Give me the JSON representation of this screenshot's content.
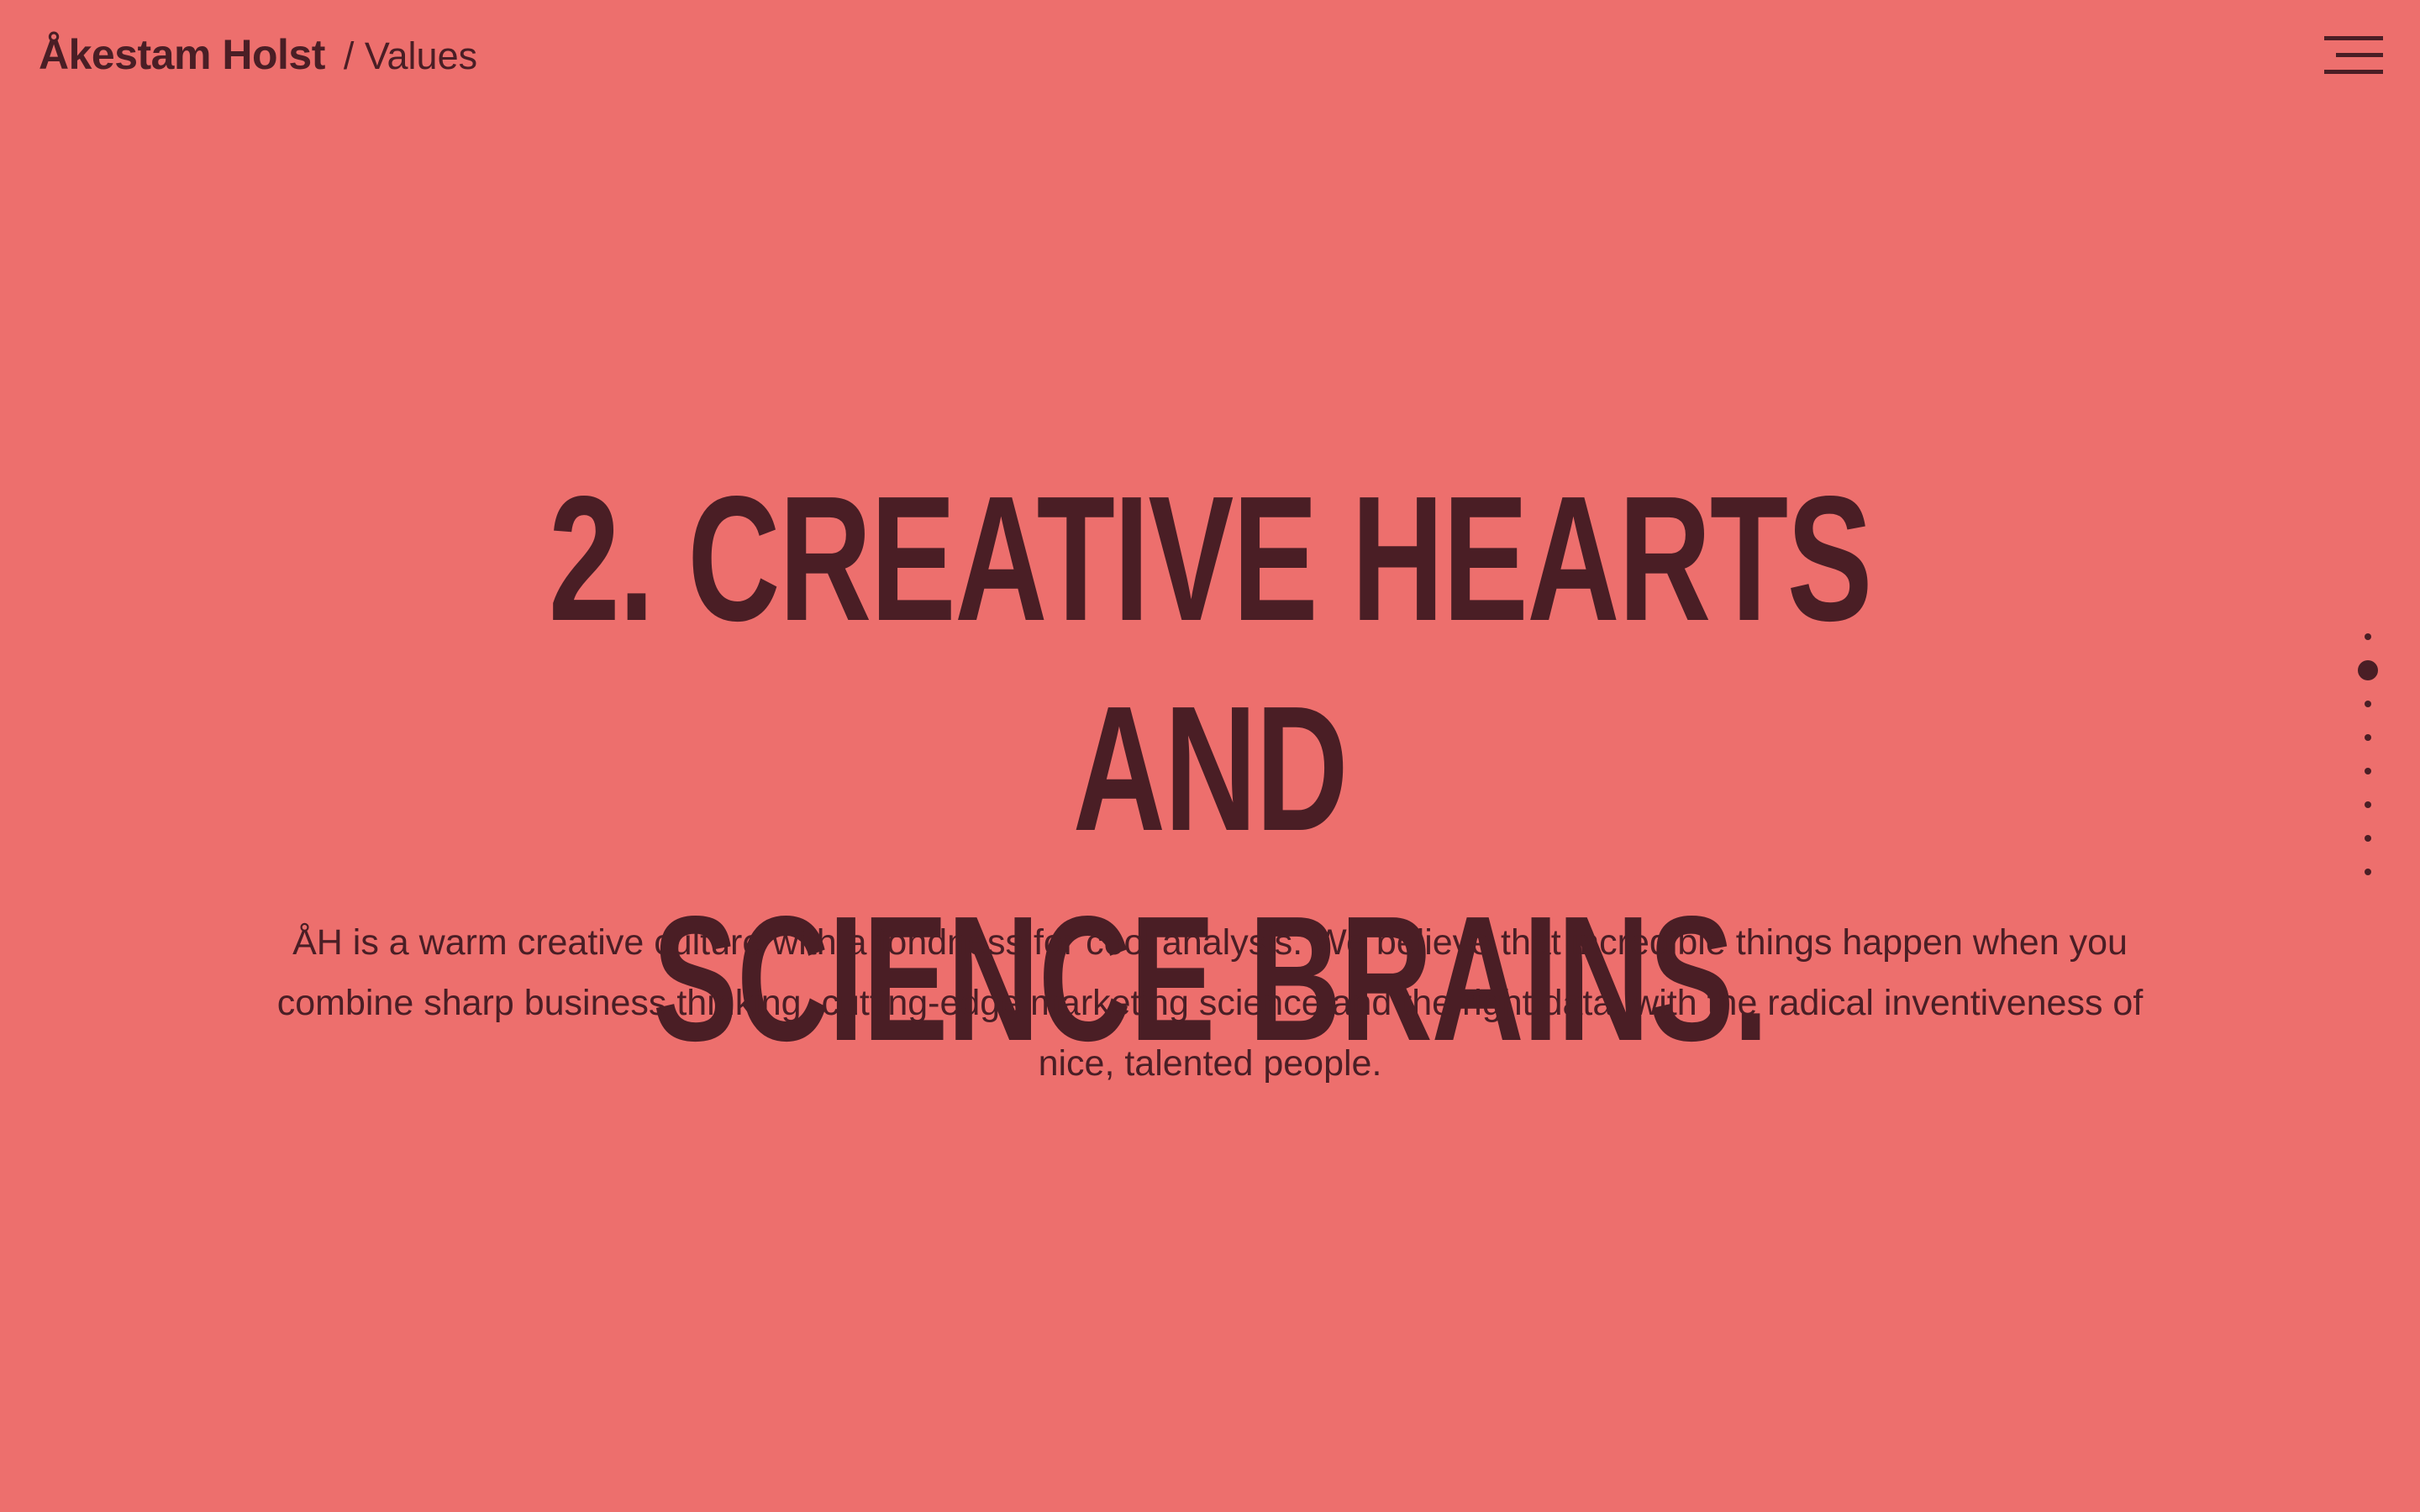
{
  "header": {
    "brand": "Åkestam Holst",
    "section": "/ Values",
    "menu_icon": "hamburger-menu-icon"
  },
  "hero": {
    "title_line1": "2. Creative hearts and",
    "title_line2": "science brains.",
    "body": "ÅH is a warm creative culture with a fondness for cool analysis. We believe that incredible things happen when you combine sharp business thinking, cutting-edge marketing science and the right data, with the radical inventiveness of nice, talented people."
  },
  "pager": {
    "total_pages": 8,
    "active_index": 1
  },
  "colors": {
    "background": "#ed6f6d",
    "foreground": "#4a1e25"
  }
}
